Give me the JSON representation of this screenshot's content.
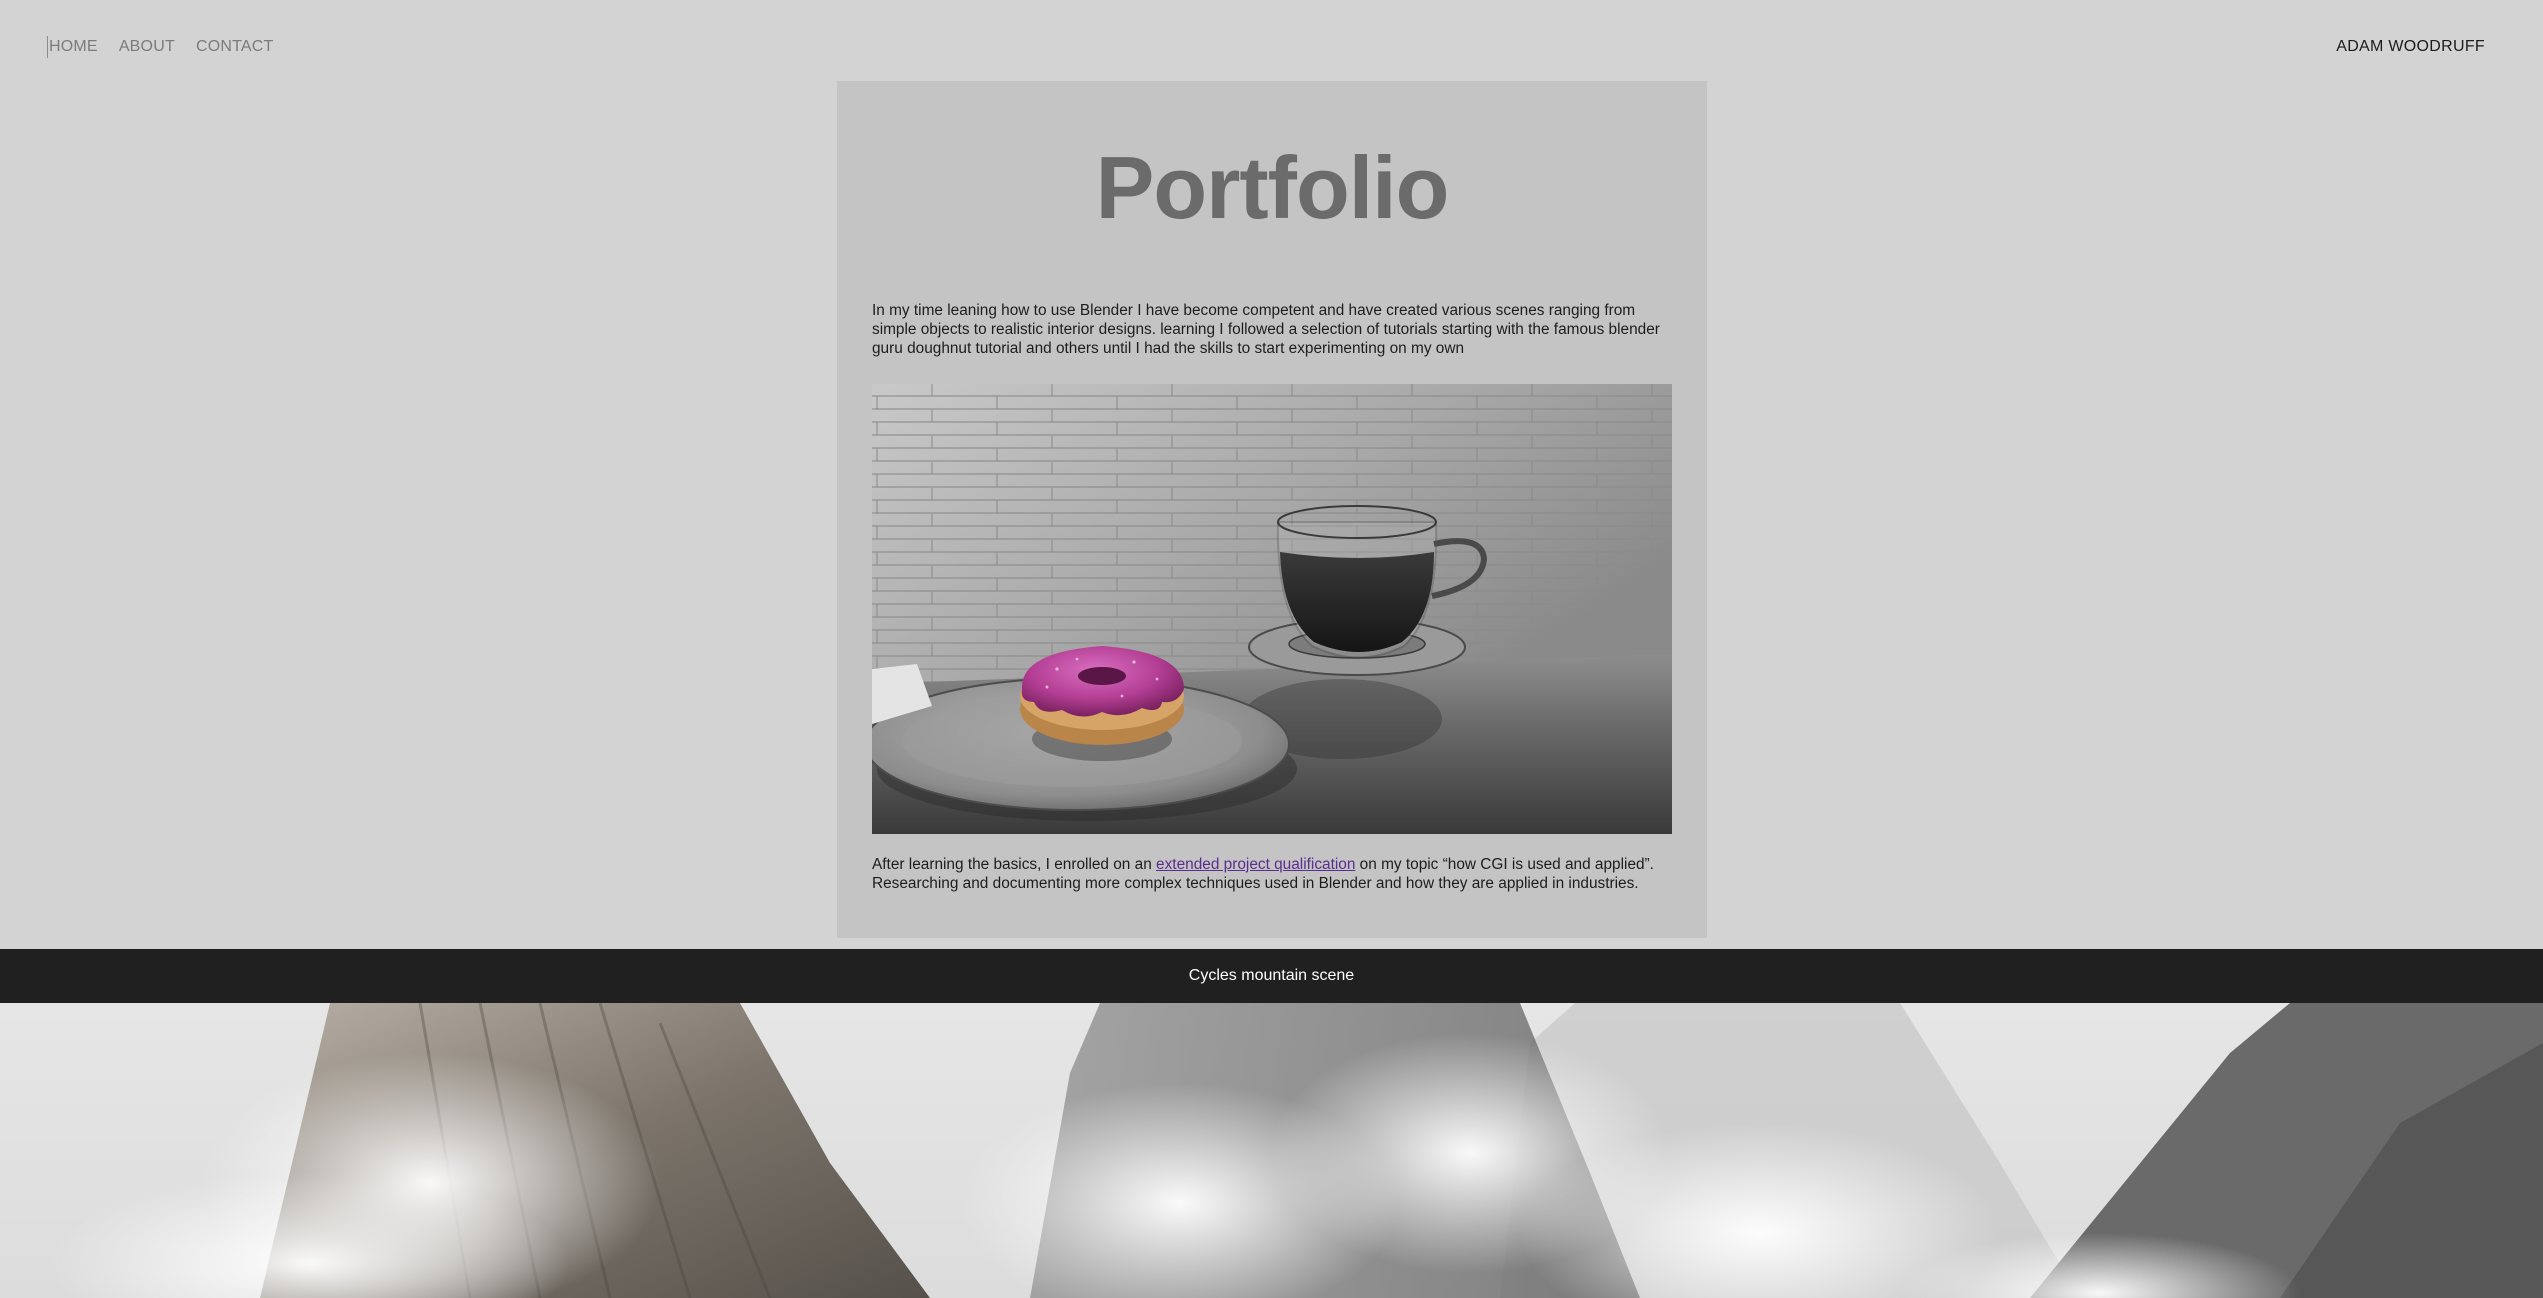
{
  "nav": {
    "home": "HOME",
    "about": "ABOUT",
    "contact": "CONTACT"
  },
  "brand": "ADAM WOODRUFF",
  "card": {
    "title": "Portfolio",
    "intro": "In my time leaning how to use Blender I have become competent and have created various scenes ranging from simple objects to realistic interior designs. learning I followed a selection of tutorials starting with the famous blender guru doughnut tutorial and others until I had the skills to start experimenting on my own",
    "outro_before": "After learning the basics, I enrolled on an ",
    "outro_link": "extended project qualification",
    "outro_after": " on my topic “how CGI is used and applied”. Researching and documenting more complex techniques used in Blender and how they are applied in industries."
  },
  "caption": "Cycles mountain scene",
  "colors": {
    "background": "#d3d3d3",
    "card": "#c4c4c4",
    "title": "#6b6b6b",
    "link": "#5b2d8e",
    "caption_bar": "#202020"
  }
}
